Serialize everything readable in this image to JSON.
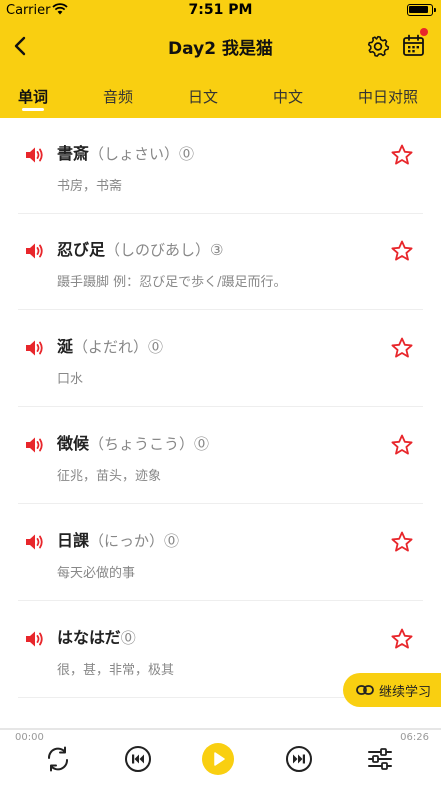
{
  "status_bar": {
    "carrier": "Carrier",
    "time": "7:51 PM"
  },
  "nav": {
    "title": "Day2 我是猫"
  },
  "tabs": [
    {
      "label": "单词",
      "active": true
    },
    {
      "label": "音频",
      "active": false
    },
    {
      "label": "日文",
      "active": false
    },
    {
      "label": "中文",
      "active": false
    },
    {
      "label": "中日对照",
      "active": false
    }
  ],
  "words": [
    {
      "kanji": "書斎",
      "reading": "（しょさい）",
      "tone": "⓪",
      "meaning": "书房，书斋"
    },
    {
      "kanji": "忍び足",
      "reading": "（しのびあし）",
      "tone": "③",
      "meaning": "蹑手蹑脚 例：忍び足で歩く/蹑足而行。"
    },
    {
      "kanji": "涎",
      "reading": "（よだれ）",
      "tone": "⓪",
      "meaning": "口水"
    },
    {
      "kanji": "徴候",
      "reading": "（ちょうこう）",
      "tone": "⓪",
      "meaning": "征兆，苗头，迹象"
    },
    {
      "kanji": "日課",
      "reading": "（にっか）",
      "tone": "⓪",
      "meaning": "每天必做的事"
    },
    {
      "kanji": "はなはだ",
      "reading": "",
      "tone": "⓪",
      "meaning": "很，甚，非常，极其"
    }
  ],
  "continue_button": {
    "label": "继续学习"
  },
  "player": {
    "current_time": "00:00",
    "total_time": "06:26",
    "progress": 0
  },
  "colors": {
    "brand": "#f9cf11",
    "speaker": "#e8262b",
    "star": "#e8262b"
  },
  "icons": {
    "back": "chevron-left-icon",
    "settings": "gear-icon",
    "calendar": "calendar-icon",
    "word_audio": "speaker-icon",
    "favorite": "star-outline-icon",
    "continue": "link-icon",
    "repeat": "repeat-icon",
    "previous": "previous-track-icon",
    "play": "play-icon",
    "next": "next-track-icon",
    "settings_player": "sliders-icon"
  }
}
